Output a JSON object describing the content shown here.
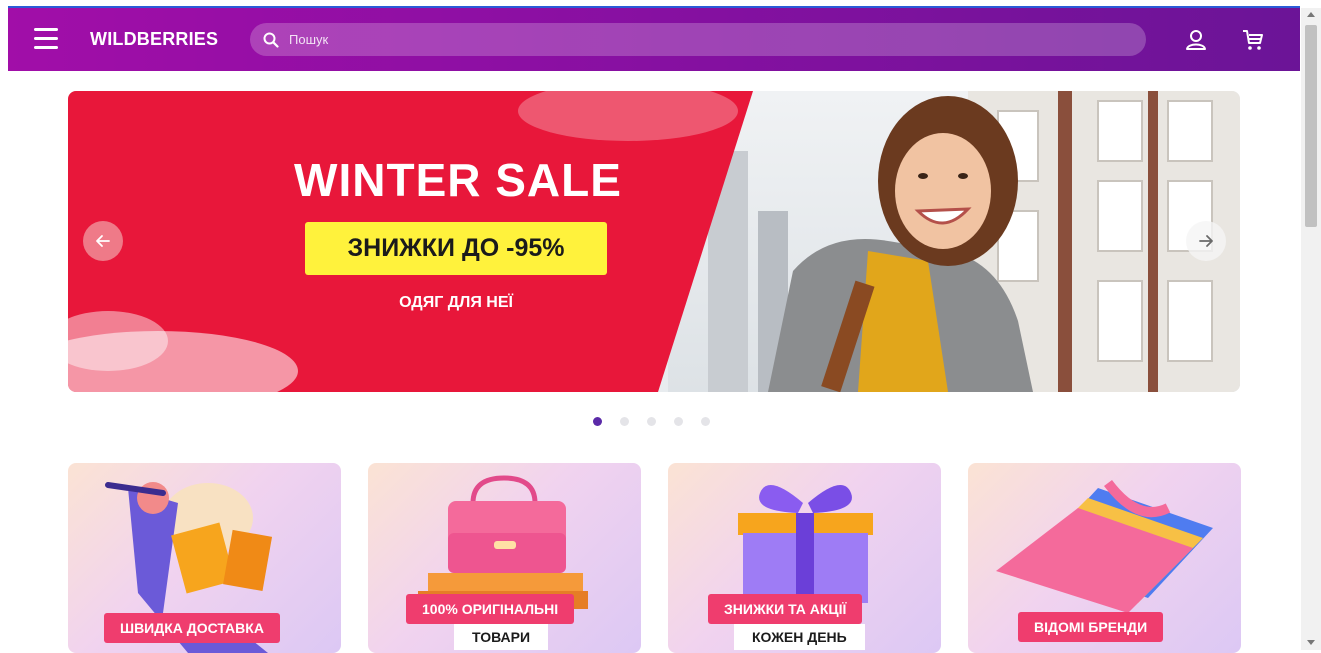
{
  "header": {
    "logo": "WILDBERRIES",
    "search_placeholder": "Пошук",
    "icons": [
      "menu-icon",
      "search-icon",
      "user-icon",
      "cart-icon"
    ],
    "background_colors": [
      "#a10ea8",
      "#6b1497"
    ]
  },
  "banner": {
    "title": "WINTER SALE",
    "badge": "ЗНИЖКИ ДО -95%",
    "subtitle": "ОДЯГ ДЛЯ НЕЇ",
    "accent": "#e8173a",
    "badge_color": "#fff23c",
    "slides_total": 5,
    "active_slide": 1
  },
  "promos": [
    {
      "line1": "ШВИДКА ДОСТАВКА",
      "line2": ""
    },
    {
      "line1": "100% ОРИГІНАЛЬНІ",
      "line2": "ТОВАРИ"
    },
    {
      "line1": "ЗНИЖКИ ТА АКЦІЇ",
      "line2": "КОЖЕН ДЕНЬ"
    },
    {
      "line1": "ВІДОМІ БРЕНДИ",
      "line2": ""
    }
  ]
}
